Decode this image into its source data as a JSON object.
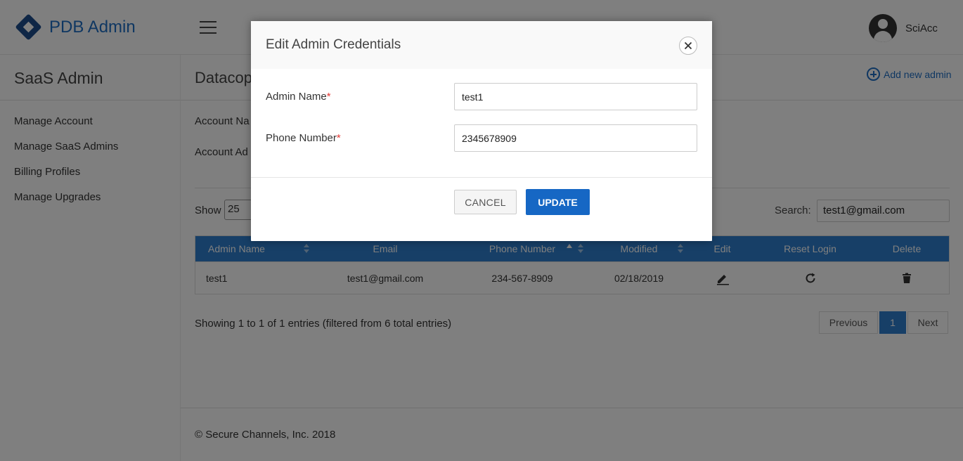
{
  "app": {
    "title": "PDB Admin"
  },
  "user": {
    "name": "SciAcc"
  },
  "sidebar": {
    "title": "SaaS Admin",
    "items": [
      {
        "label": "Manage Account"
      },
      {
        "label": "Manage SaaS Admins"
      },
      {
        "label": "Billing Profiles"
      },
      {
        "label": "Manage Upgrades"
      }
    ]
  },
  "main": {
    "title": "Datacop",
    "add_admin_label": "Add new admin",
    "account_name_label": "Account Na",
    "account_address_label": "Account Ad",
    "show_label": "Show",
    "show_value": "25",
    "search_label": "Search:",
    "search_value": "test1@gmail.com"
  },
  "table": {
    "headers": [
      "Admin Name",
      "Email",
      "Phone Number",
      "Modified",
      "Edit",
      "Reset Login",
      "Delete"
    ],
    "rows": [
      {
        "admin_name": "test1",
        "email": "test1@gmail.com",
        "phone": "234-567-8909",
        "modified": "02/18/2019"
      }
    ]
  },
  "pagination": {
    "info": "Showing 1 to 1 of 1 entries (filtered from 6 total entries)",
    "previous": "Previous",
    "current": "1",
    "next": "Next"
  },
  "footer": {
    "text": "© Secure Channels, Inc. 2018"
  },
  "modal": {
    "title": "Edit Admin Credentials",
    "admin_name_label": "Admin Name",
    "admin_name_value": "test1",
    "phone_label": "Phone Number",
    "phone_value": "2345678909",
    "required_mark": "*",
    "cancel_label": "CANCEL",
    "update_label": "UPDATE"
  },
  "colors": {
    "brand_blue": "#1f6fc5",
    "table_header": "#2e7fcf",
    "primary_button": "#1667c4",
    "required": "#e53935"
  }
}
